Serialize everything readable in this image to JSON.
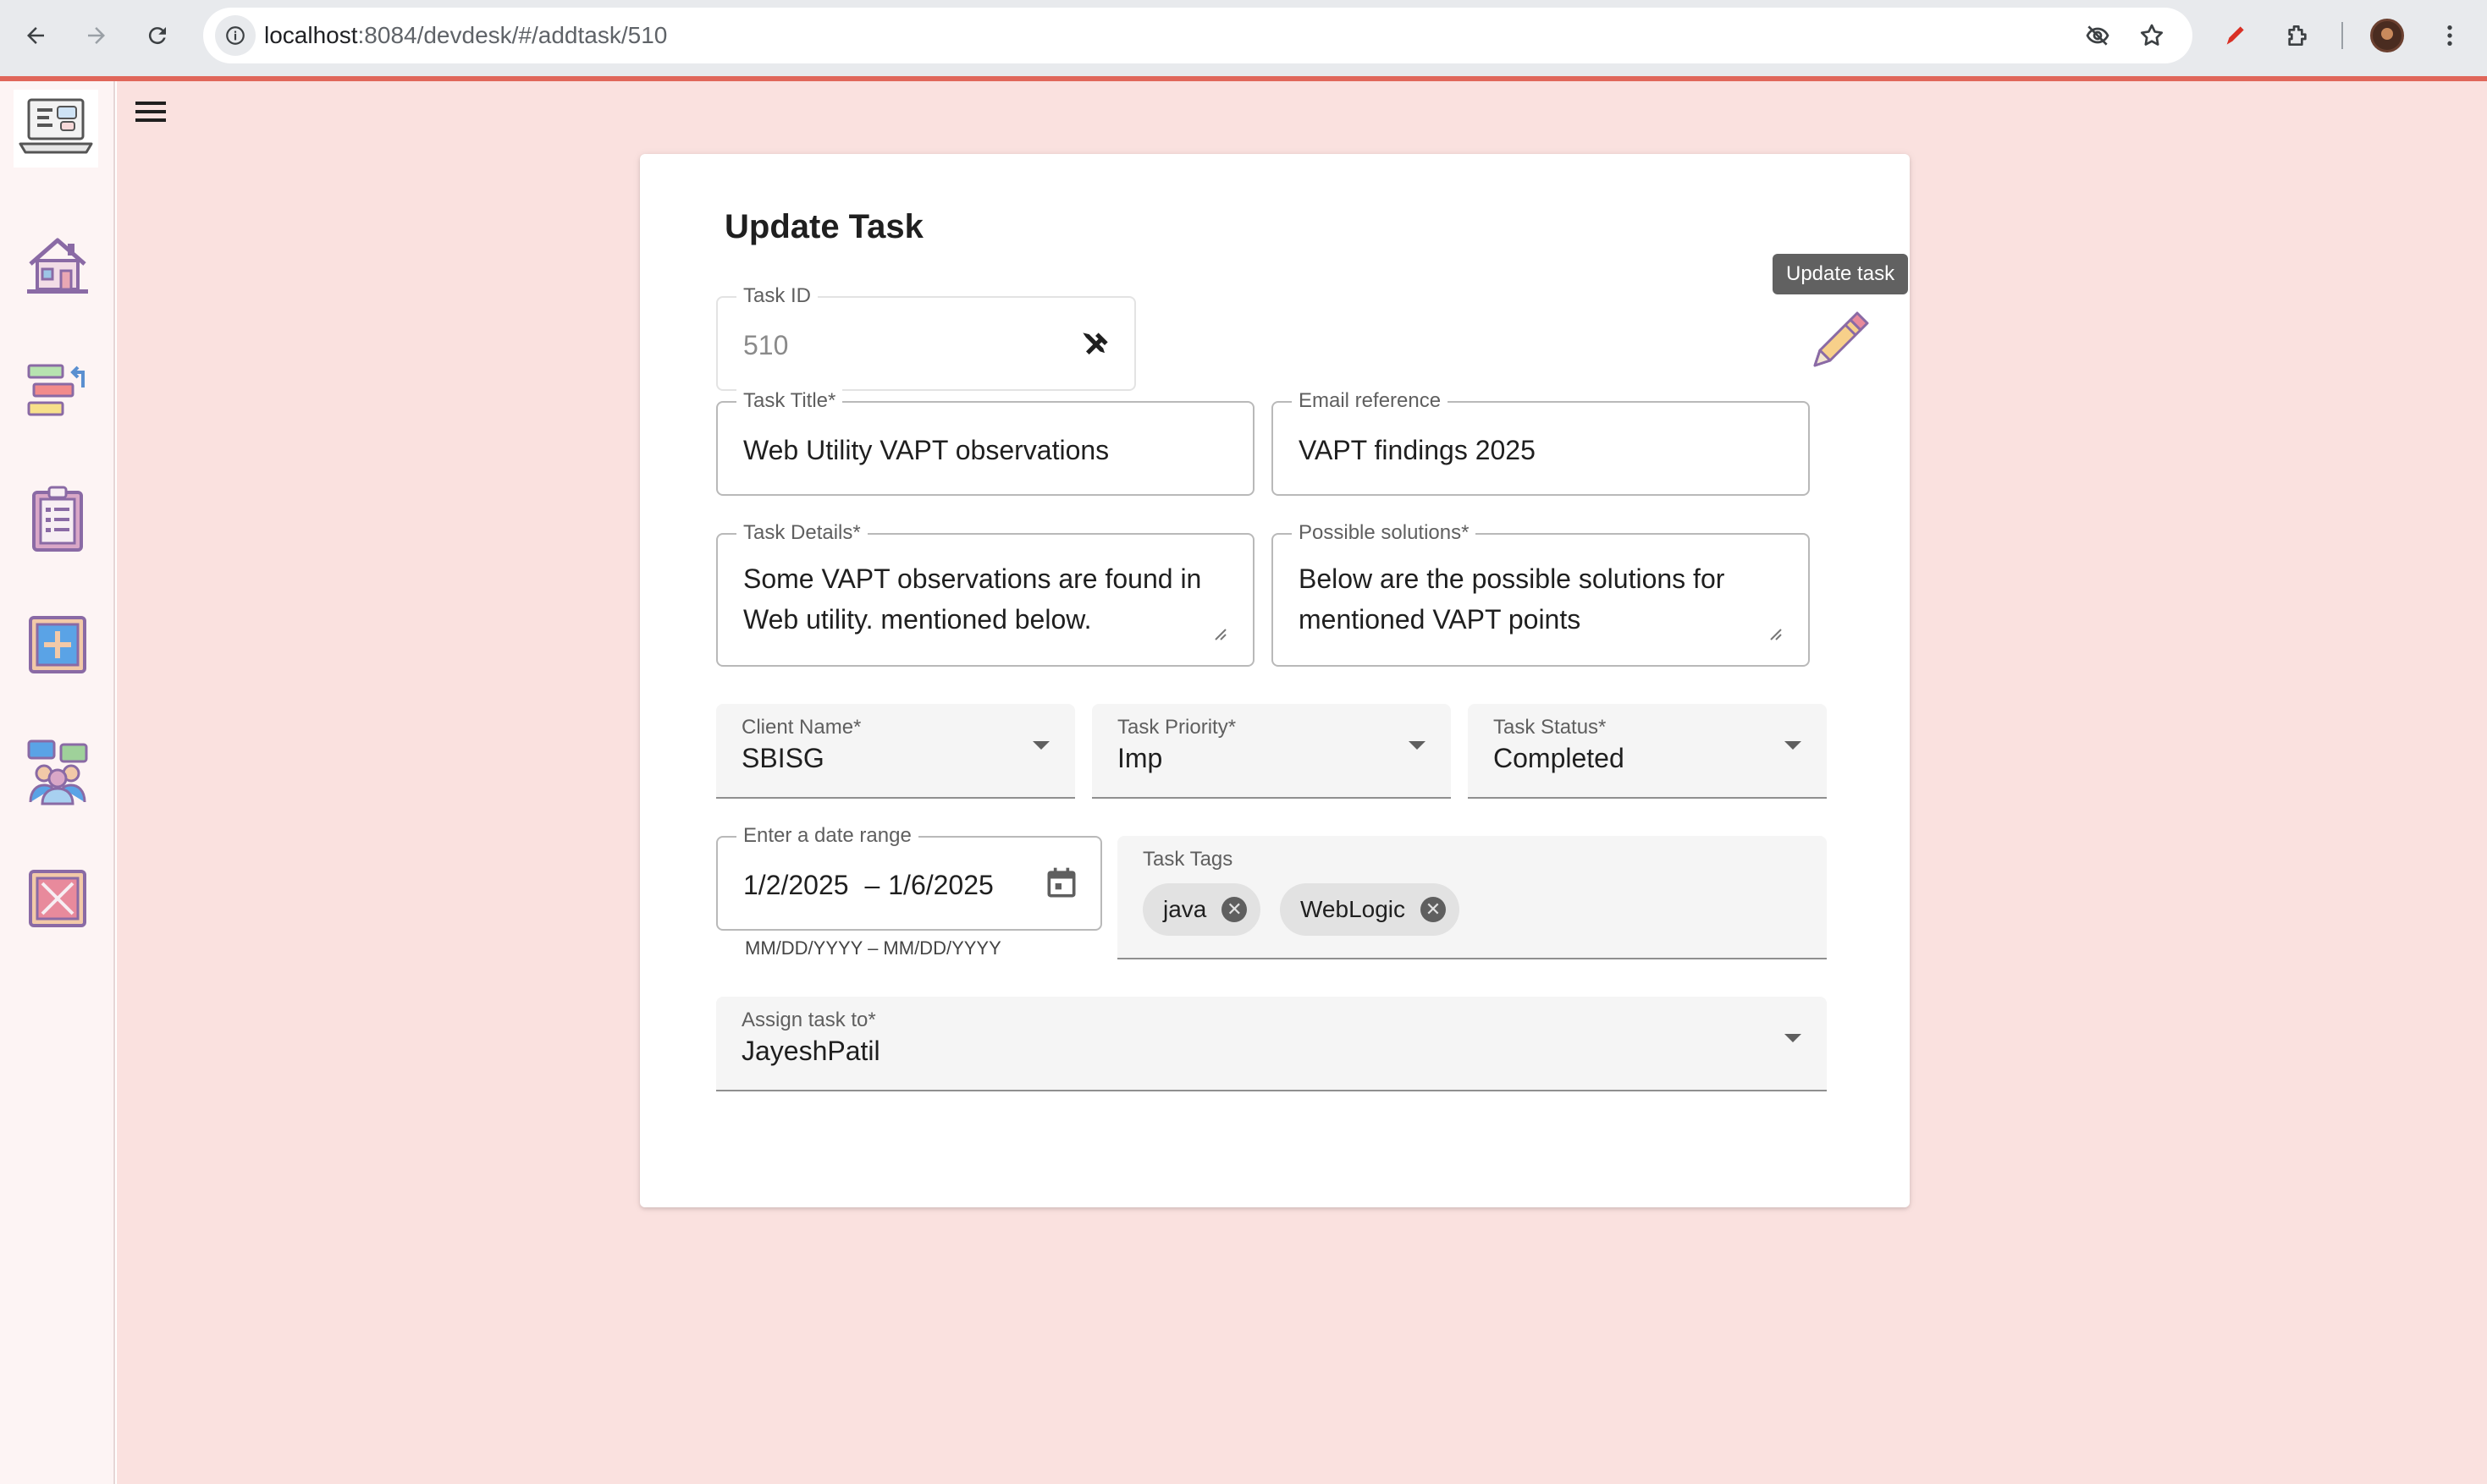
{
  "browser": {
    "url_host": "localhost",
    "url_rest": ":8084/devdesk/#/addtask/510"
  },
  "form": {
    "title": "Update Task",
    "tooltip": "Update task",
    "task_id": {
      "label": "Task ID",
      "value": "510"
    },
    "task_title": {
      "label": "Task Title*",
      "value": "Web Utility VAPT observations"
    },
    "email_reference": {
      "label": "Email reference",
      "value": "VAPT findings 2025"
    },
    "task_details": {
      "label": "Task Details*",
      "value": "Some VAPT observations are found in Web utility. mentioned below."
    },
    "possible_solutions": {
      "label": "Possible solutions*",
      "value": "Below are the possible solutions for mentioned VAPT points"
    },
    "client_name": {
      "label": "Client Name*",
      "value": "SBISG"
    },
    "task_priority": {
      "label": "Task Priority*",
      "value": "Imp"
    },
    "task_status": {
      "label": "Task Status*",
      "value": "Completed"
    },
    "date_range": {
      "label": "Enter a date range",
      "start": "1/2/2025",
      "separator": "–",
      "end": "1/6/2025",
      "hint": "MM/DD/YYYY – MM/DD/YYYY"
    },
    "task_tags": {
      "label": "Task Tags",
      "chips": [
        "java",
        "WebLogic"
      ]
    },
    "assign_to": {
      "label": "Assign task to*",
      "value": "JayeshPatil"
    }
  },
  "sidebar": {
    "items": [
      "home-icon",
      "task-flow-icon",
      "clipboard-icon",
      "add-task-icon",
      "team-icon",
      "close-box-icon"
    ]
  },
  "colors": {
    "background": "#fae1df",
    "accent_line": "#e0665a",
    "card": "#ffffff"
  }
}
